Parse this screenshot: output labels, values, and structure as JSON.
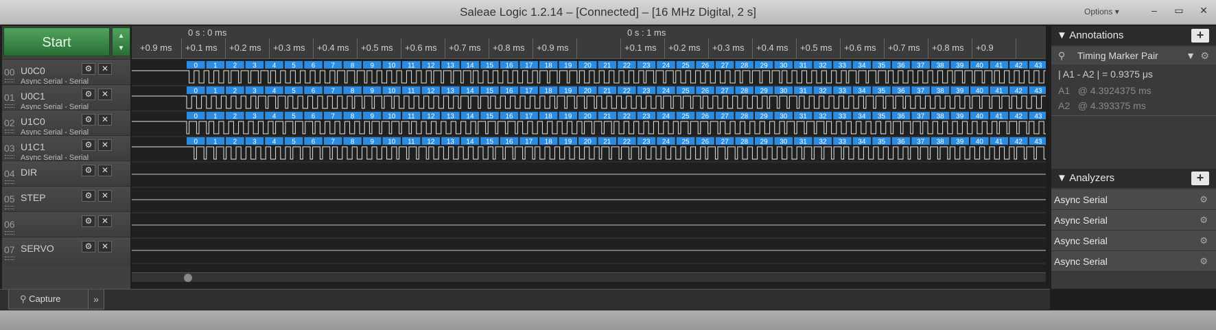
{
  "window": {
    "title": "Saleae Logic 1.2.14 – [Connected] – [16 MHz Digital, 2 s]",
    "options_label": "Options ▾",
    "minimize": "–",
    "maximize": "▭",
    "close": "✕"
  },
  "controls": {
    "start_label": "Start",
    "arrows": "▲ ▼"
  },
  "channels": [
    {
      "num": "00",
      "name": "U0C0",
      "sub": "Async Serial - Serial",
      "color": "#888888",
      "active": true
    },
    {
      "num": "01",
      "name": "U0C1",
      "sub": "Async Serial - Serial",
      "color": "#b5651d",
      "active": true
    },
    {
      "num": "02",
      "name": "U1C0",
      "sub": "Async Serial - Serial",
      "color": "#d12a2a",
      "active": true
    },
    {
      "num": "03",
      "name": "U1C1",
      "sub": "Async Serial - Serial",
      "color": "#e8801a",
      "active": true
    },
    {
      "num": "04",
      "name": "DIR",
      "sub": "",
      "color": "#e8c61a",
      "active": false
    },
    {
      "num": "05",
      "name": "STEP",
      "sub": "",
      "color": "#5fb830",
      "active": false
    },
    {
      "num": "06",
      "name": "",
      "sub": "",
      "color": "#3f5fd8",
      "active": false
    },
    {
      "num": "07",
      "name": "SERVO",
      "sub": "",
      "color": "#b23ad6",
      "active": false
    }
  ],
  "ruler": {
    "major": [
      "0 s : 0 ms",
      "0 s : 1 ms"
    ],
    "minor_left": "+0.9 ms",
    "minor": [
      "+0.1 ms",
      "+0.2 ms",
      "+0.3 ms",
      "+0.4 ms",
      "+0.5 ms",
      "+0.6 ms",
      "+0.7 ms",
      "+0.8 ms",
      "+0.9 ms",
      "+0.1 ms",
      "+0.2 ms",
      "+0.3 ms",
      "+0.4 ms",
      "+0.5 ms",
      "+0.6 ms",
      "+0.7 ms",
      "+0.8 ms",
      "+0.9"
    ]
  },
  "frame_labels": [
    "0",
    "1",
    "2",
    "3",
    "4",
    "5",
    "6",
    "7",
    "8",
    "9",
    "10",
    "11",
    "12",
    "13",
    "14",
    "15",
    "16",
    "17",
    "18",
    "19",
    "20",
    "21",
    "22",
    "23",
    "24",
    "25",
    "26",
    "27",
    "28",
    "29",
    "30",
    "31",
    "32",
    "33",
    "34",
    "35",
    "36",
    "37",
    "38",
    "39",
    "40",
    "41",
    "42",
    "43",
    "4"
  ],
  "annotations": {
    "header": "Annotations",
    "plus": "+",
    "marker_type": "Timing Marker Pair",
    "diff_line": "| A1 - A2 | = 0.9375 μs",
    "a1_label": "A1",
    "a1_value": "@  4.3924375 ms",
    "a2_label": "A2",
    "a2_value": "@  4.393375 ms"
  },
  "analyzers": {
    "header": "Analyzers",
    "plus": "+",
    "items": [
      "Async Serial",
      "Async Serial",
      "Async Serial",
      "Async Serial"
    ]
  },
  "tabs": {
    "capture": "Capture",
    "more": "»"
  },
  "colors": {
    "frame_blue": "#2a8be0",
    "trace": "#e8e8e8",
    "start_green": "#3a8a48"
  }
}
